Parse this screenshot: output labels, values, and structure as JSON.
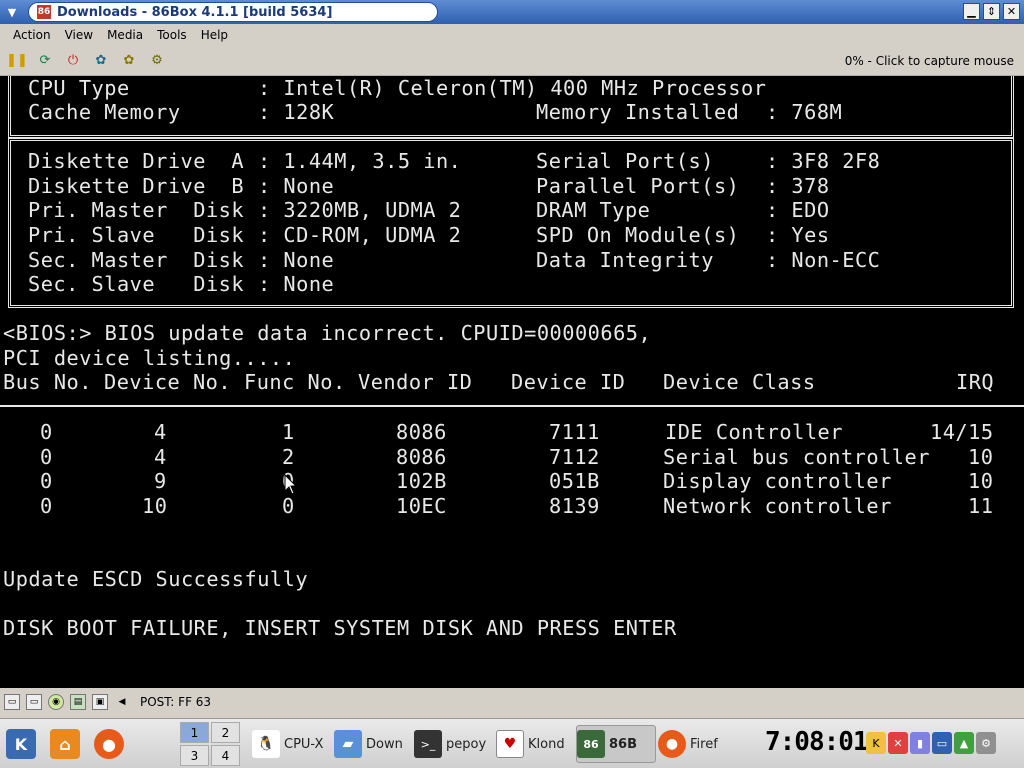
{
  "window": {
    "title": "Downloads - 86Box 4.1.1 [build 5634]"
  },
  "menu": {
    "items": [
      "Action",
      "View",
      "Media",
      "Tools",
      "Help"
    ]
  },
  "toolbar": {
    "icons": [
      "pause-icon",
      "reset-icon",
      "power-icon",
      "ctrl-alt-del-icon",
      "ctrl-alt-esc-icon",
      "settings-icon"
    ],
    "capture_text": "0% - Click to capture mouse"
  },
  "bios": {
    "cpu_type_label": "CPU Type",
    "cpu_type_value": ": Intel(R) Celeron(TM) 400 MHz Processor",
    "cache_label": "Cache Memory",
    "cache_value": ": 128K",
    "mem_label": "Memory Installed",
    "mem_value": ": 768M",
    "left_rows": [
      {
        "label": "Diskette Drive  A",
        "value": ": 1.44M, 3.5 in."
      },
      {
        "label": "Diskette Drive  B",
        "value": ": None"
      },
      {
        "label": "Pri. Master  Disk",
        "value": ": 3220MB, UDMA 2"
      },
      {
        "label": "Pri. Slave   Disk",
        "value": ": CD-ROM, UDMA 2"
      },
      {
        "label": "Sec. Master  Disk",
        "value": ": None"
      },
      {
        "label": "Sec. Slave   Disk",
        "value": ": None"
      }
    ],
    "right_rows": [
      {
        "label": "Serial Port(s)",
        "value": ": 3F8 2F8"
      },
      {
        "label": "Parallel Port(s)",
        "value": ": 378"
      },
      {
        "label": "DRAM Type",
        "value": ": EDO"
      },
      {
        "label": "SPD On Module(s)",
        "value": ": Yes"
      },
      {
        "label": "Data Integrity",
        "value": ": Non-ECC"
      }
    ],
    "bios_msg": "<BIOS:> BIOS update data incorrect. CPUID=00000665,",
    "pci_listing": "PCI device listing.....",
    "pci_headers": [
      "Bus No.",
      "Device No.",
      "Func No.",
      "Vendor ID",
      "Device ID",
      "Device Class",
      "IRQ"
    ],
    "pci_rows": [
      [
        "0",
        "4",
        "1",
        "8086",
        "7111",
        "IDE Controller",
        "14/15"
      ],
      [
        "0",
        "4",
        "2",
        "8086",
        "7112",
        "Serial bus controller",
        "10"
      ],
      [
        "0",
        "9",
        "0",
        "102B",
        "051B",
        "Display controller",
        "10"
      ],
      [
        "0",
        "10",
        "0",
        "10EC",
        "8139",
        "Network controller",
        "11"
      ]
    ],
    "escd_msg": "Update ESCD Successfully",
    "boot_msg": "DISK BOOT FAILURE, INSERT SYSTEM DISK AND PRESS ENTER"
  },
  "status": {
    "post": "POST: FF 63"
  },
  "taskbar": {
    "pager": [
      "1",
      "2",
      "3",
      "4"
    ],
    "tasks": [
      "CPU-X",
      "Down",
      "pepoy",
      "Klond",
      "86B",
      "Firef"
    ],
    "clock": "7:08:01"
  }
}
